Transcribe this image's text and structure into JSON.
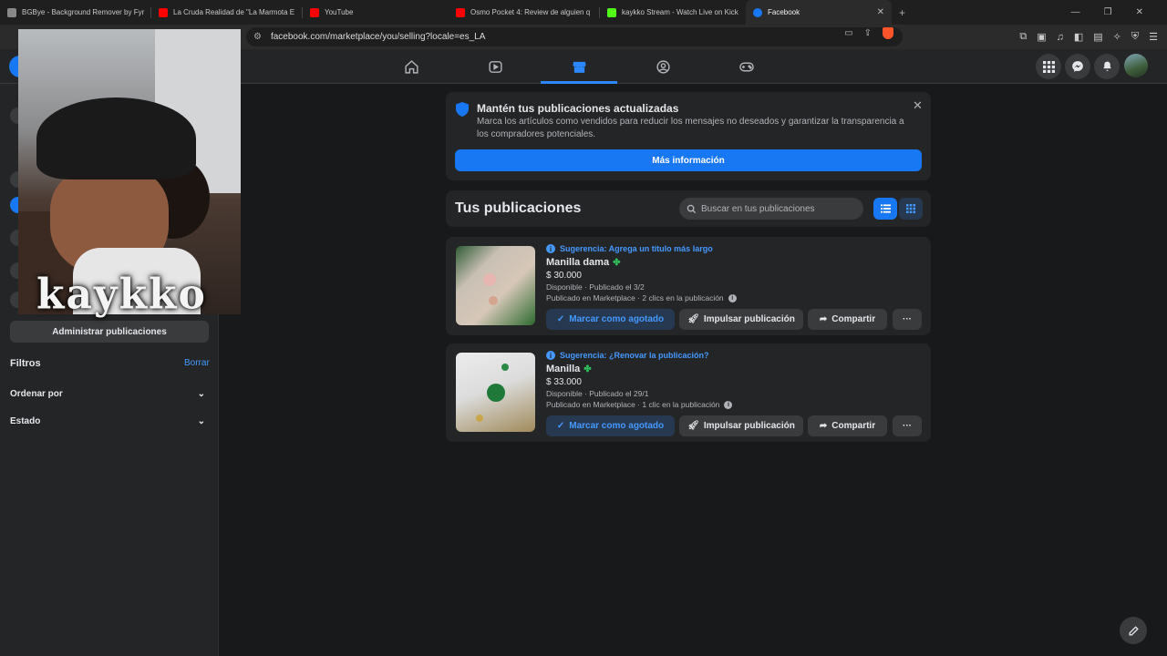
{
  "browser": {
    "tabs": [
      {
        "title": "BGBye - Background Remover by Fyr",
        "color": "#888888"
      },
      {
        "title": "La Cruda Realidad de \"La Marmota E",
        "color": "#ff0000"
      },
      {
        "title": "YouTube",
        "color": "#ff0000"
      },
      {
        "title": "Osmo Pocket 4: Review de alguien q",
        "color": "#ff0000"
      },
      {
        "title": "kaykko Stream - Watch Live on Kick",
        "color": "#53fc18"
      },
      {
        "title": "Facebook",
        "color": "#1877f2"
      }
    ],
    "url": "facebook.com/marketplace/you/selling?locale=es_LA"
  },
  "overlay": {
    "watermark": "kaykko"
  },
  "sidebar": {
    "admin_button": "Administrar publicaciones",
    "filters_title": "Filtros",
    "filters_clear": "Borrar",
    "filters": [
      {
        "label": "Ordenar por"
      },
      {
        "label": "Estado"
      }
    ]
  },
  "banner": {
    "title": "Mantén tus publicaciones actualizadas",
    "text": "Marca los artículos como vendidos para reducir los mensajes no deseados y garantizar la transparencia a los compradores potenciales.",
    "button": "Más información"
  },
  "listings": {
    "title": "Tus publicaciones",
    "search_placeholder": "Buscar en tus publicaciones",
    "items": [
      {
        "suggestion": "Sugerencia: Agrega un título más largo",
        "name": "Manilla dama",
        "price": "$ 30.000",
        "status": "Disponible · Publicado el 3/2",
        "clicks": "Publicado en Marketplace · 2 clics en la publicación"
      },
      {
        "suggestion": "Sugerencia: ¿Renovar la publicación?",
        "name": "Manilla",
        "price": "$ 33.000",
        "status": "Disponible · Publicado el 29/1",
        "clicks": "Publicado en Marketplace · 1 clic en la publicación"
      }
    ],
    "actions": {
      "sold": "Marcar como agotado",
      "boost": "Impulsar publicación",
      "share": "Compartir",
      "more": "···"
    }
  },
  "colors": {
    "accent": "#1877f2",
    "link": "#4599ff",
    "background": "#18191a",
    "card": "#242526"
  }
}
